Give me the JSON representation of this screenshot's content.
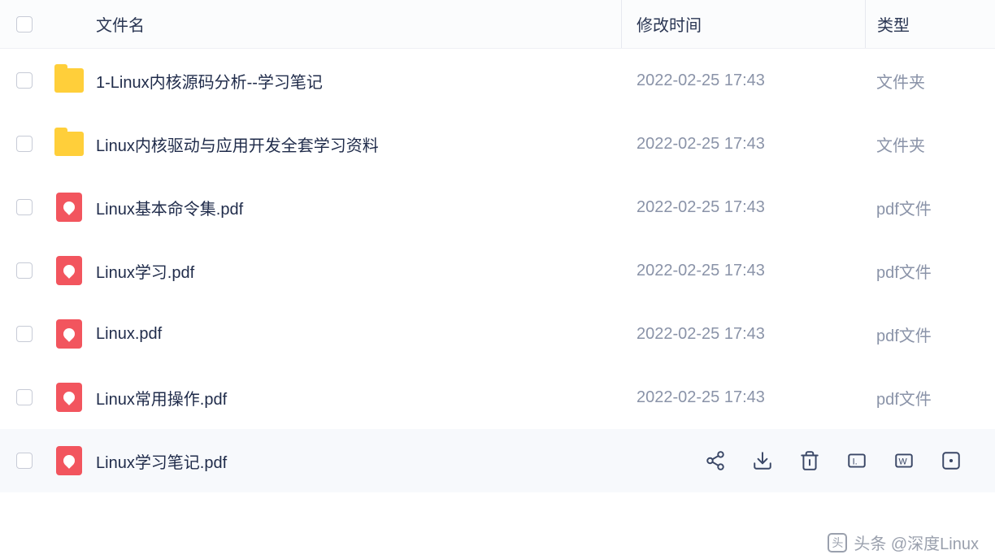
{
  "columns": {
    "name": "文件名",
    "time": "修改时间",
    "type": "类型"
  },
  "files": [
    {
      "iconType": "folder",
      "name": "1-Linux内核源码分析--学习笔记",
      "time": "2022-02-25 17:43",
      "type": "文件夹",
      "selected": false
    },
    {
      "iconType": "folder",
      "name": "Linux内核驱动与应用开发全套学习资料",
      "time": "2022-02-25 17:43",
      "type": "文件夹",
      "selected": false
    },
    {
      "iconType": "pdf",
      "name": "Linux基本命令集.pdf",
      "time": "2022-02-25 17:43",
      "type": "pdf文件",
      "selected": false
    },
    {
      "iconType": "pdf",
      "name": "Linux学习.pdf",
      "time": "2022-02-25 17:43",
      "type": "pdf文件",
      "selected": false
    },
    {
      "iconType": "pdf",
      "name": "Linux.pdf",
      "time": "2022-02-25 17:43",
      "type": "pdf文件",
      "selected": false
    },
    {
      "iconType": "pdf",
      "name": "Linux常用操作.pdf",
      "time": "2022-02-25 17:43",
      "type": "pdf文件",
      "selected": false
    },
    {
      "iconType": "pdf",
      "name": "Linux学习笔记.pdf",
      "time": "",
      "type": "",
      "selected": true
    }
  ],
  "actions": {
    "share": "share-icon",
    "download": "download-icon",
    "delete": "delete-icon",
    "rename": "rename-icon",
    "move": "move-icon",
    "more": "more-icon"
  },
  "watermark": "头条 @深度Linux"
}
